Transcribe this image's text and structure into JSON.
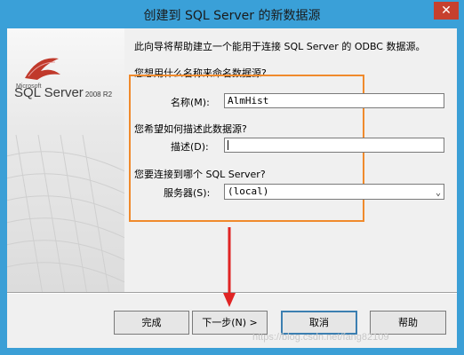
{
  "window": {
    "title": "创建到 SQL Server 的新数据源",
    "close_glyph": "✕"
  },
  "logo": {
    "company": "Microsoft",
    "product": "SQL Server",
    "version": "2008 R2"
  },
  "intro_text": "此向导将帮助建立一个能用于连接 SQL Server 的 ODBC 数据源。",
  "q_name": "您想用什么名称来命名数据源?",
  "name": {
    "label": "名称(M):",
    "value": "AlmHist"
  },
  "q_desc": "您希望如何描述此数据源?",
  "desc": {
    "label": "描述(D):",
    "value": ""
  },
  "q_server": "您要连接到哪个 SQL Server?",
  "server": {
    "label": "服务器(S):",
    "value": "(local)",
    "options": [
      "(local)"
    ]
  },
  "buttons": {
    "finish": "完成",
    "next": "下一步(N) >",
    "cancel": "取消",
    "help": "帮助"
  },
  "watermark": "https://blog.csdn.net/fang82109",
  "colors": {
    "titlebar": "#3aa0d8",
    "close_button": "#c7402e",
    "highlight_box": "#f08a2c",
    "annotation_arrow": "#e02424"
  },
  "icons": [
    "close-icon",
    "dropdown-arrow-icon",
    "annotation-arrow-icon"
  ]
}
